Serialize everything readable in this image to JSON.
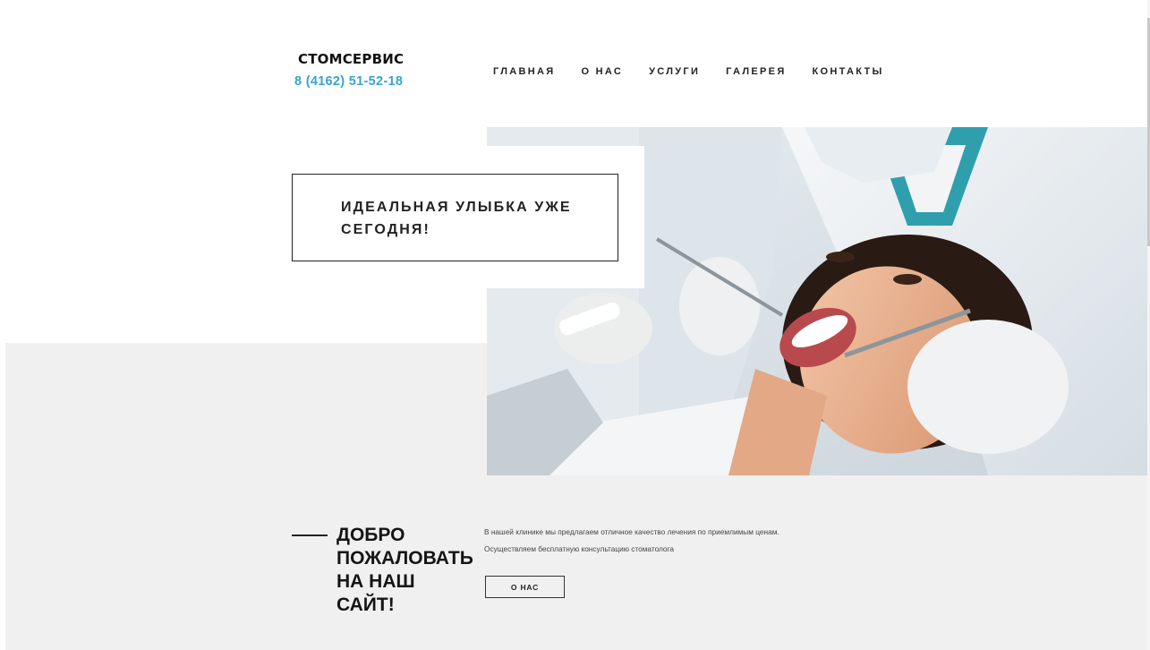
{
  "header": {
    "brand": "СТОМСЕРВИС",
    "phone": "8 (4162) 51-52-18"
  },
  "nav": {
    "items": [
      {
        "label": "ГЛАВНАЯ"
      },
      {
        "label": "О НАС"
      },
      {
        "label": "УСЛУГИ"
      },
      {
        "label": "ГАЛЕРЕЯ"
      },
      {
        "label": "КОНТАКТЫ"
      }
    ]
  },
  "hero": {
    "tagline_line1": "ИДЕАЛЬНАЯ УЛЫБКА УЖЕ",
    "tagline_line2": "СЕГОДНЯ!"
  },
  "welcome": {
    "heading_line1": "ДОБРО",
    "heading_line2": "ПОЖАЛОВАТЬ",
    "heading_line3": "НА НАШ",
    "heading_line4": "САЙТ!",
    "text1": "В нашей клинике мы предлагаем отличное качество лечения по приемлимым ценам.",
    "text2": "Осуществляем бесплатную консультацию стоматолога",
    "button_label": "О НАС"
  },
  "colors": {
    "accent": "#3aa3cf",
    "band": "#f0f0f0",
    "text": "#1a1a1a"
  }
}
